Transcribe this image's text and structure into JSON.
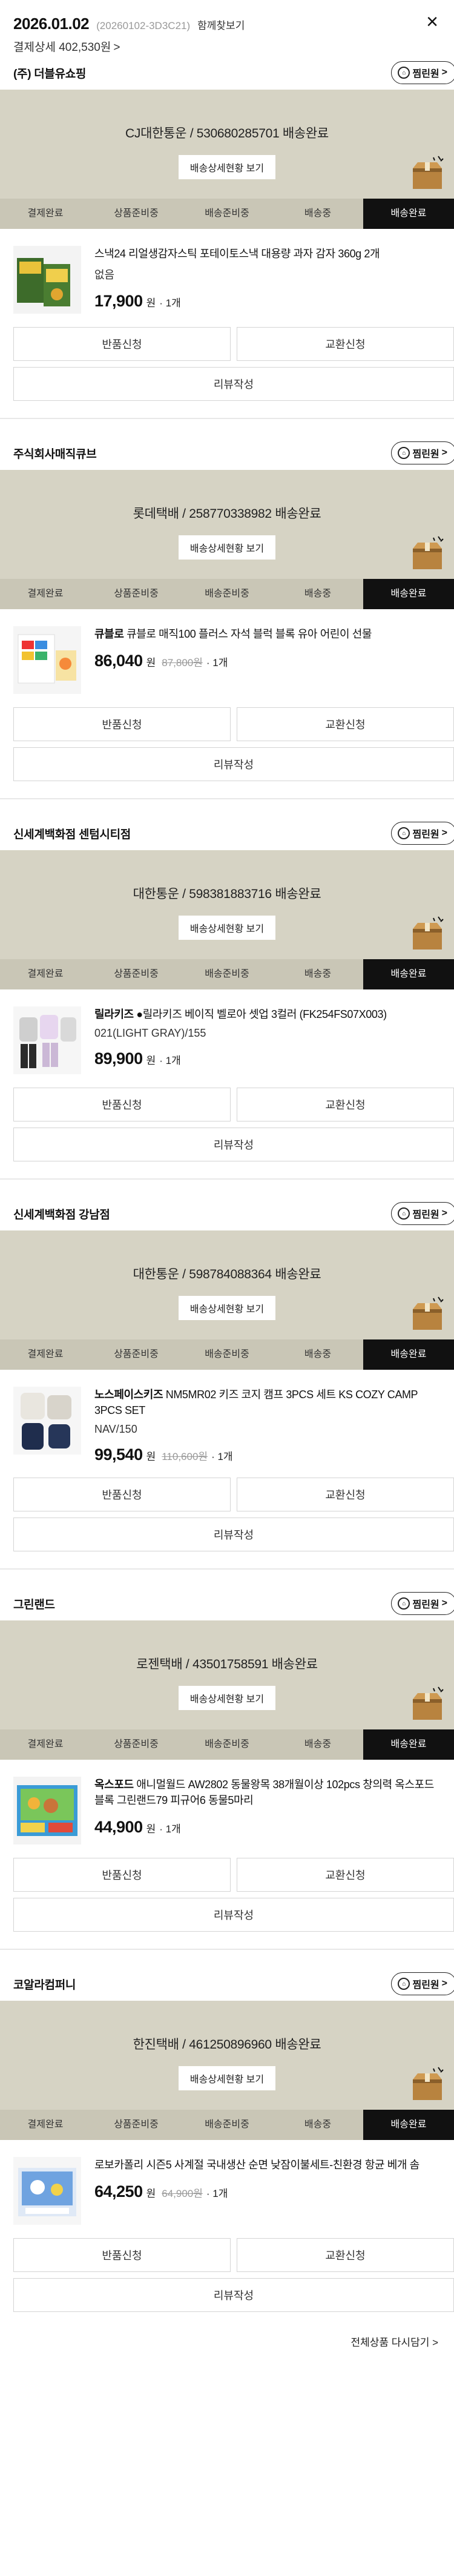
{
  "order": {
    "date": "2026.01.02",
    "number": "(20260102-3D3C21)",
    "detail_button": "함께찾보기",
    "close": "×",
    "payment": "결제상세 402,530원",
    "payment_chevron": ">"
  },
  "labels": {
    "store_button": "찜린원",
    "store_chevron": ">",
    "track": "배송상세현황 보기",
    "return": "반품신청",
    "exchange": "교환신청",
    "review": "리뷰작성",
    "won": "원",
    "qty": "· 1개",
    "steps": [
      "결제완료",
      "상품준비중",
      "배송준비중",
      "배송중",
      "배송완료"
    ]
  },
  "stores": [
    {
      "name": "(주) 더블유쇼핑",
      "courier": "CJ대한통운 / 530680285701 배송완료",
      "product": {
        "brand": "",
        "title": "스낵24 리얼생감자스틱 포테이토스낵 대용량 과자 감자 360g 2개",
        "option": "없음",
        "price": "17,900",
        "original": ""
      }
    },
    {
      "name": "주식회사매직큐브",
      "courier": "롯데택배 / 258770338982 배송완료",
      "product": {
        "brand": "큐블로",
        "title": "큐블로 매직100 플러스 자석 블럭 블록 유아 어린이 선물",
        "option": "",
        "price": "86,040",
        "original": "87,800원"
      }
    },
    {
      "name": "신세계백화점 센텀시티점",
      "courier": "대한통운 / 598381883716 배송완료",
      "product": {
        "brand": "릴라키즈",
        "title": "●릴라키즈 베이직 벨로아 셋업 3컬러 (FK254FS07X003)",
        "option": "021(LIGHT GRAY)/155",
        "price": "89,900",
        "original": ""
      }
    },
    {
      "name": "신세계백화점 강남점",
      "courier": "대한통운 / 598784088364 배송완료",
      "product": {
        "brand": "노스페이스키즈",
        "title": "NM5MR02 키즈 코지 캠프 3PCS 세트 KS COZY CAMP 3PCS SET",
        "option": "NAV/150",
        "price": "99,540",
        "original": "110,600원"
      }
    },
    {
      "name": "그린랜드",
      "courier": "로젠택배 / 43501758591 배송완료",
      "product": {
        "brand": "옥스포드",
        "title": "애니멀월드 AW2802 동물왕목 38개월이상 102pcs 창의력 옥스포드 블록 그린랜드79 피규어6 동물5마리",
        "option": "",
        "price": "44,900",
        "original": ""
      }
    },
    {
      "name": "코알라컴퍼니",
      "courier": "한진택배 / 461250896960 배송완료",
      "product": {
        "brand": "",
        "title": "로보카폴리 시즌5 사계절 국내생산 순면 낮잠이불세트-친환경 항균 베개 솜",
        "option": "",
        "price": "64,250",
        "original": "64,900원"
      }
    }
  ],
  "footer": {
    "all_products": "전체상품 다시담기 >"
  },
  "colors": {
    "ship_bg": "#d6d3c4",
    "steps_bg": "#c9c6b6",
    "active_step": "#111111"
  }
}
